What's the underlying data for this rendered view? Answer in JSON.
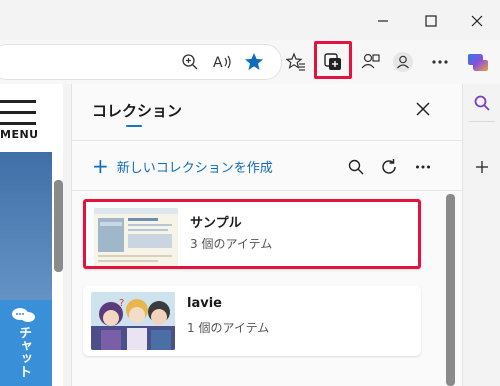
{
  "window": {
    "minimize_icon": "minimize-icon",
    "maximize_icon": "maximize-icon",
    "close_icon": "close-icon"
  },
  "toolbar": {
    "zoom_icon": "zoom-icon",
    "read_aloud_icon": "read-aloud-icon",
    "favorite_icon": "star-icon",
    "favorites_icon": "favorites-icon",
    "collections_icon": "collections-icon",
    "extensions_icon": "extensions-icon",
    "profile_icon": "profile-icon",
    "more_icon": "more-icon",
    "copilot_icon": "copilot-icon"
  },
  "page": {
    "menu_label": "MENU",
    "chat_label": "チャット"
  },
  "panel": {
    "title": "コレクション",
    "new_collection_label": "新しいコレクションを作成",
    "collections": [
      {
        "title": "サンプル",
        "subtitle": "3 個のアイテム",
        "selected": true
      },
      {
        "title": "lavie",
        "subtitle": "1 個のアイテム",
        "selected": false
      }
    ]
  },
  "colors": {
    "accent": "#0f6cbd",
    "highlight": "#e2143d"
  }
}
